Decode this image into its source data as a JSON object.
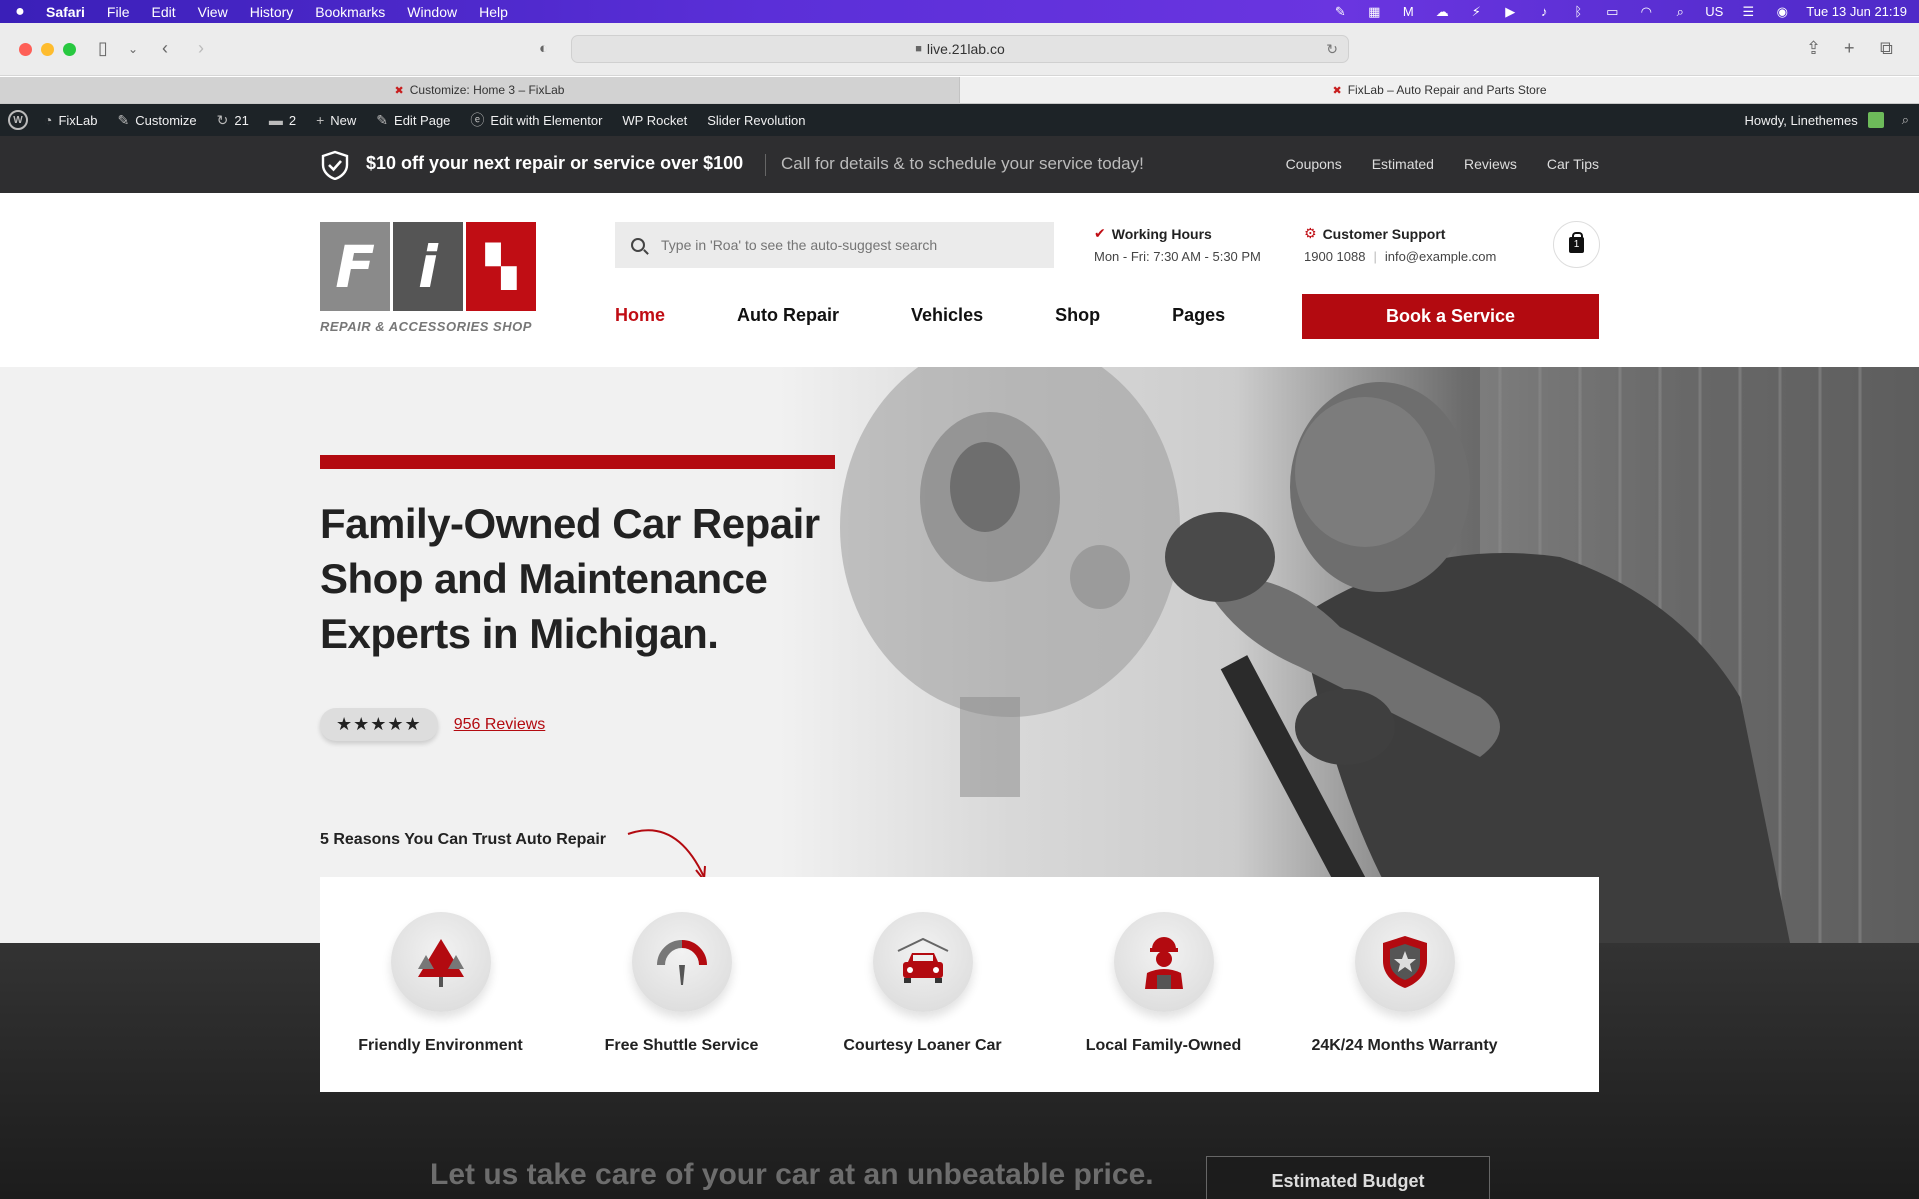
{
  "menubar": {
    "app": "Safari",
    "items": [
      "File",
      "Edit",
      "View",
      "History",
      "Bookmarks",
      "Window",
      "Help"
    ],
    "clock": "Tue 13 Jun  21:19",
    "input_source": "US"
  },
  "browser": {
    "url": "live.21lab.co",
    "tabs": [
      {
        "label": "Customize: Home 3 – FixLab"
      },
      {
        "label": "FixLab – Auto Repair and Parts Store"
      }
    ]
  },
  "wp_admin": {
    "site": "FixLab",
    "customize": "Customize",
    "updates": "21",
    "comments": "2",
    "new": "New",
    "edit_page": "Edit Page",
    "elementor": "Edit with Elementor",
    "wp_rocket": "WP Rocket",
    "slider": "Slider Revolution",
    "howdy": "Howdy, Linethemes"
  },
  "promo": {
    "headline": "$10 off your next repair or service over $100",
    "sub": "Call for details & to schedule your service today!",
    "links": [
      "Coupons",
      "Estimated",
      "Reviews",
      "Car Tips"
    ]
  },
  "header": {
    "logo_tagline": "REPAIR & ACCESSORIES SHOP",
    "search_placeholder": "Type in 'Roa' to see the auto-suggest search",
    "hours_title": "Working Hours",
    "hours": "Mon - Fri: 7:30 AM - 5:30 PM",
    "support_title": "Customer Support",
    "phone": "1900 1088",
    "email": "info@example.com",
    "cart_count": "1",
    "nav": [
      "Home",
      "Auto Repair",
      "Vehicles",
      "Shop",
      "Pages"
    ],
    "book": "Book a Service"
  },
  "hero": {
    "title": "Family-Owned Car Repair Shop and Maintenance Experts in Michigan.",
    "stars": "★★★★★",
    "reviews": "956 Reviews",
    "trust_label": "5 Reasons You Can Trust Auto Repair"
  },
  "features": [
    {
      "label": "Friendly Environment",
      "icon": "tree-icon"
    },
    {
      "label": "Free Shuttle Service",
      "icon": "gauge-icon"
    },
    {
      "label": "Courtesy Loaner Car",
      "icon": "car-icon"
    },
    {
      "label": "Local Family-Owned",
      "icon": "worker-icon"
    },
    {
      "label": "24K/24 Months Warranty",
      "icon": "shield-star-icon"
    }
  ],
  "bottom": {
    "tagline": "Let us take care of your car at an unbeatable price.",
    "estimated": "Estimated Budget"
  },
  "colors": {
    "accent": "#b30a10",
    "dark": "#2e2e30"
  }
}
